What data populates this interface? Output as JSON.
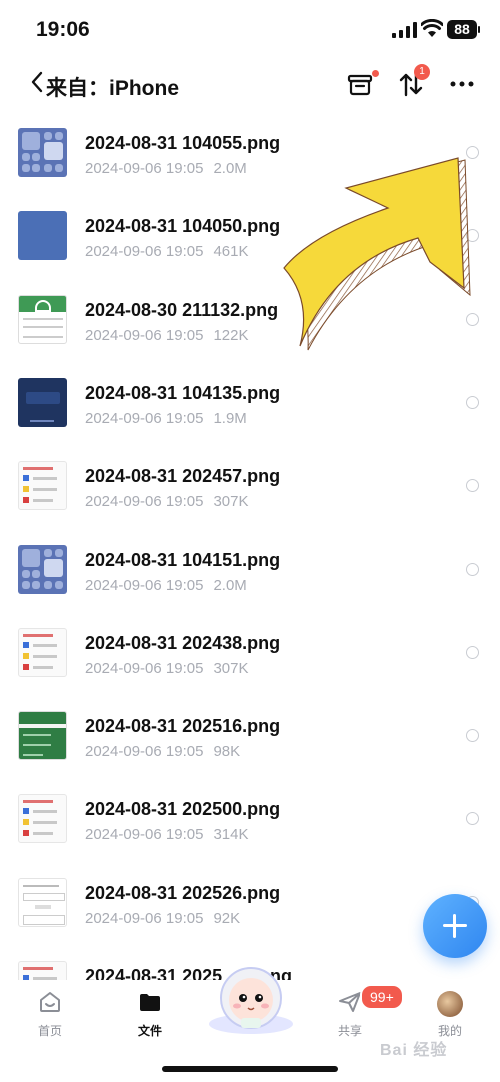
{
  "status": {
    "time": "19:06",
    "battery": "88"
  },
  "header": {
    "back_icon": "chevron-left-icon",
    "title": "来自：iPhone",
    "upload_badge": "1"
  },
  "files": [
    {
      "name": "2024-08-31 104055.png",
      "date": "2024-09-06 19:05",
      "size": "2.0M",
      "thumb": "cc"
    },
    {
      "name": "2024-08-31 104050.png",
      "date": "2024-09-06 19:05",
      "size": "461K",
      "thumb": "blue"
    },
    {
      "name": "2024-08-30 211132.png",
      "date": "2024-09-06 19:05",
      "size": "122K",
      "thumb": "green"
    },
    {
      "name": "2024-08-31 104135.png",
      "date": "2024-09-06 19:05",
      "size": "1.9M",
      "thumb": "navy"
    },
    {
      "name": "2024-08-31 202457.png",
      "date": "2024-09-06 19:05",
      "size": "307K",
      "thumb": "doc"
    },
    {
      "name": "2024-08-31 104151.png",
      "date": "2024-09-06 19:05",
      "size": "2.0M",
      "thumb": "cc"
    },
    {
      "name": "2024-08-31 202438.png",
      "date": "2024-09-06 19:05",
      "size": "307K",
      "thumb": "doc"
    },
    {
      "name": "2024-08-31 202516.png",
      "date": "2024-09-06 19:05",
      "size": "98K",
      "thumb": "greenapp"
    },
    {
      "name": "2024-08-31 202500.png",
      "date": "2024-09-06 19:05",
      "size": "314K",
      "thumb": "doc"
    },
    {
      "name": "2024-08-31 202526.png",
      "date": "2024-09-06 19:05",
      "size": "92K",
      "thumb": "form"
    },
    {
      "name": "2024-08-31 2025",
      "name_tail": "ng",
      "date": "",
      "size": "",
      "thumb": "doc"
    }
  ],
  "tabs": [
    {
      "label": "首页",
      "icon": "home-icon"
    },
    {
      "label": "文件",
      "icon": "folder-icon"
    },
    {
      "label": "共享",
      "icon": "send-icon"
    },
    {
      "label": "我的",
      "icon": "avatar"
    }
  ],
  "share_badge": "99+",
  "watermark": "Bai 经验",
  "colors": {
    "accent": "#2f86f0",
    "badge": "#f25a4d",
    "meta": "#a8abb3",
    "arrow": "#f6d93a"
  }
}
